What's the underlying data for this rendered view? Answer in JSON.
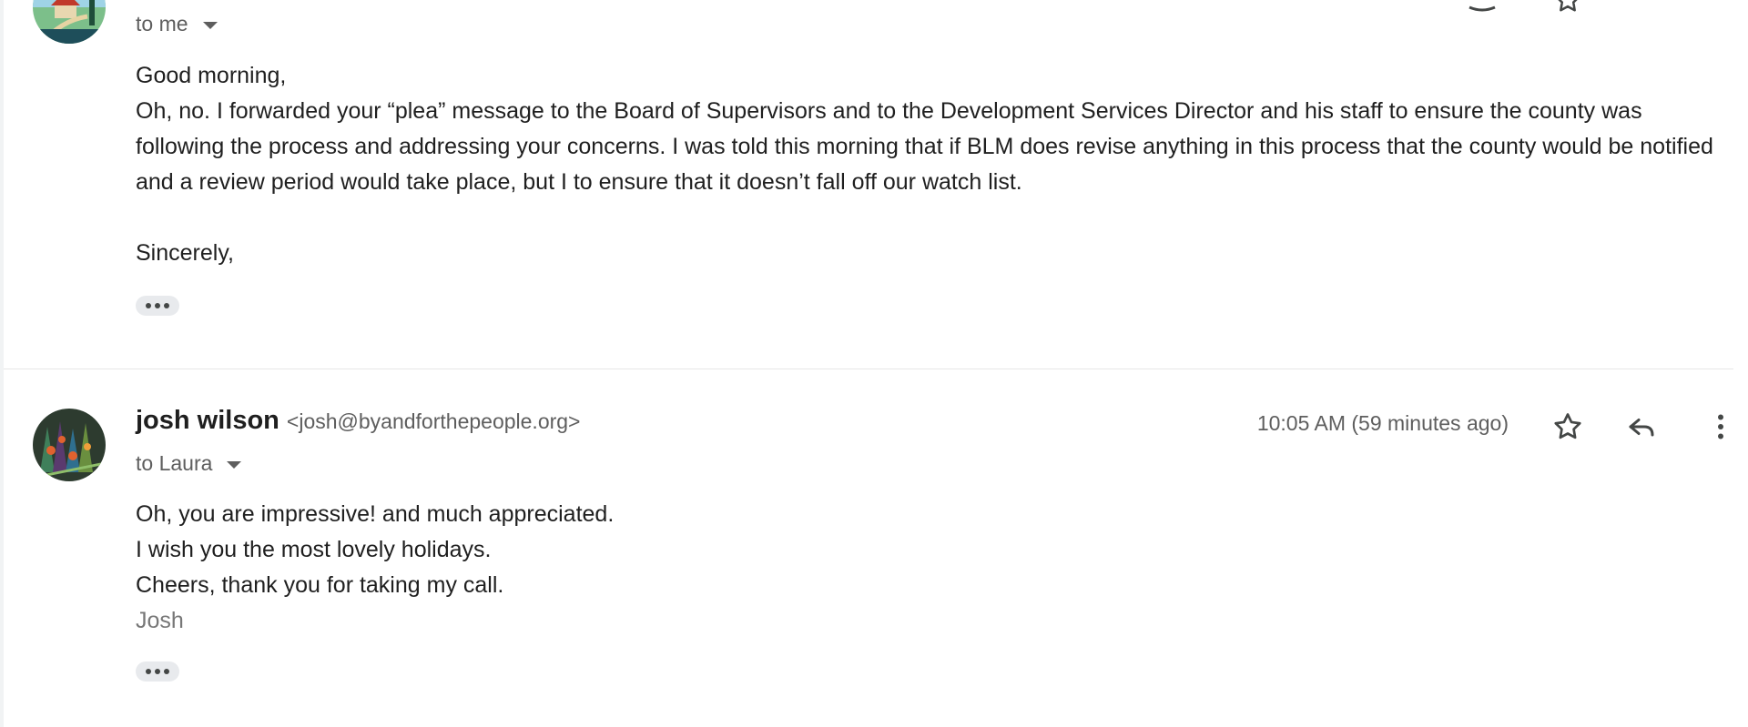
{
  "message1": {
    "recipient_label": "to me",
    "greeting": "Good morning,",
    "paragraph": "Oh, no. I forwarded your “plea” message to the Board of Supervisors and to the Development Services Director and his staff to ensure the county was following the process and addressing your concerns. I was told this morning that if BLM does revise anything in this process that the county would be notified and a review period would take place, but I to ensure that it doesn’t fall off our watch list.",
    "closing": "Sincerely,"
  },
  "message2": {
    "sender_name": "josh wilson",
    "sender_email": "<josh@byandforthepeople.org>",
    "recipient_label": "to Laura",
    "time": "10:05 AM (59 minutes ago)",
    "lines": [
      "Oh, you are impressive! and much appreciated.",
      "I wish you the most lovely holidays.",
      "Cheers, thank you for taking my call."
    ],
    "signature": "Josh"
  },
  "icons": {
    "star": "star-icon",
    "reply": "reply-icon",
    "more": "more-vert-icon",
    "ellipsis": "show-trimmed-content-icon"
  },
  "colors": {
    "text_primary": "#1f1f1f",
    "text_secondary": "#5e5e5e",
    "signature": "#777777",
    "ellipsis_bg": "#e8eaed"
  }
}
